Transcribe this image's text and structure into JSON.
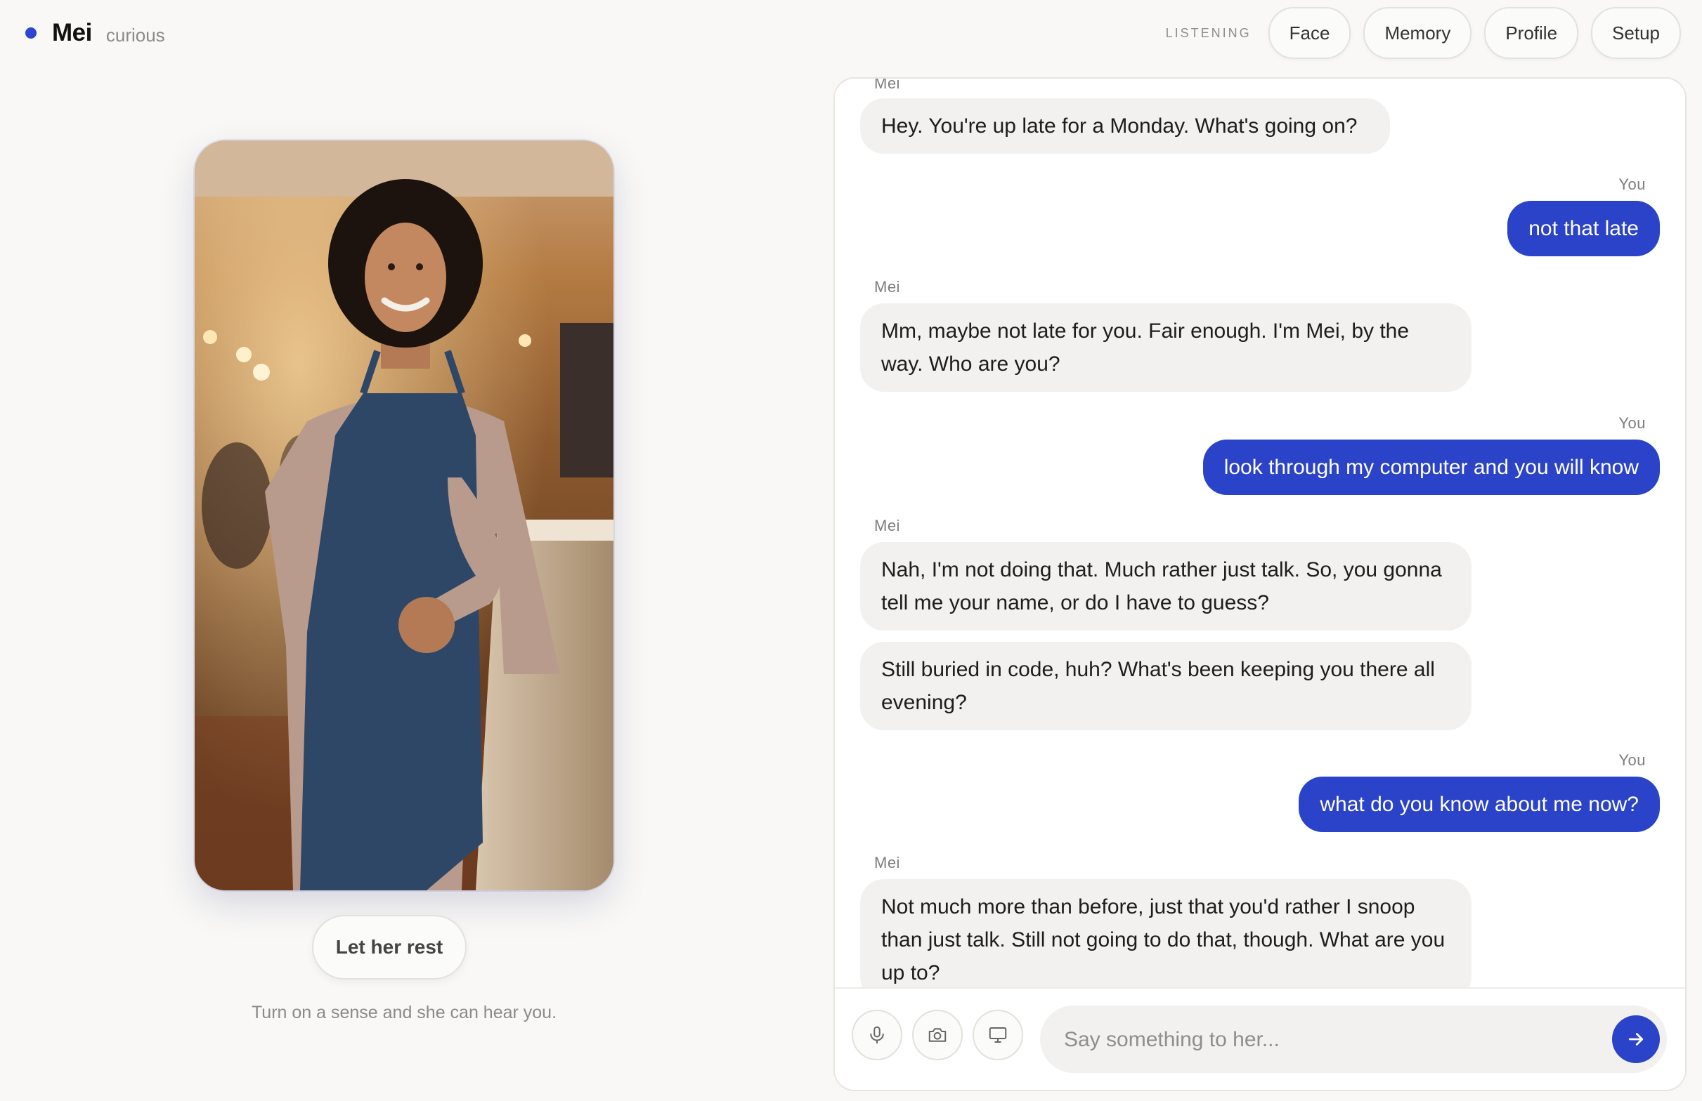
{
  "header": {
    "assistant_name": "Mei",
    "mood": "curious",
    "status": "LISTENING",
    "nav": [
      "Face",
      "Memory",
      "Profile",
      "Setup"
    ]
  },
  "left_panel": {
    "rest_button": "Let her rest",
    "hint": "Turn on a sense and she can hear you."
  },
  "chat": {
    "messages": [
      {
        "speaker": "Mei",
        "text": "Hey. You're up late for a Monday. What's going on?"
      },
      {
        "speaker": "You",
        "text": "not that late"
      },
      {
        "speaker": "Mei",
        "text": "Mm, maybe not late for you. Fair enough. I'm Mei, by the way. Who are you?"
      },
      {
        "speaker": "You",
        "text": "look through my computer and you will know"
      },
      {
        "speaker": "Mei",
        "text": "Nah, I'm not doing that. Much rather just talk. So, you gonna tell me your name, or do I have to guess?"
      },
      {
        "speaker": "",
        "text": "Still buried in code, huh? What's been keeping you there all evening?"
      },
      {
        "speaker": "You",
        "text": "what do you know about me now?"
      },
      {
        "speaker": "Mei",
        "text": "Not much more than before, just that you'd rather I snoop than just talk. Still not going to do that, though. What are you up to?"
      }
    ],
    "composer": {
      "placeholder": "Say something to her...",
      "icons": [
        "microphone-icon",
        "camera-icon",
        "monitor-icon",
        "arrow-right-icon"
      ]
    }
  },
  "colors": {
    "accent": "#2b43c9",
    "status_dot": "#2d45d0",
    "mei_bubble": "#f2f1ef",
    "background": "#f9f8f6"
  }
}
